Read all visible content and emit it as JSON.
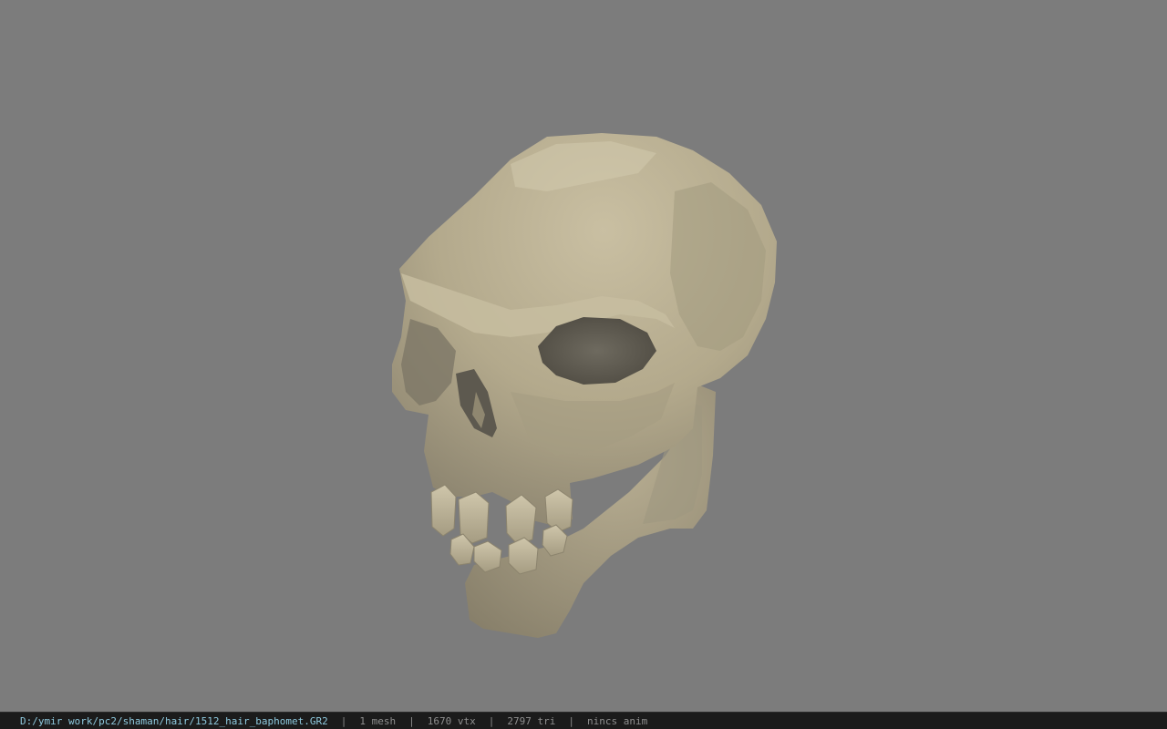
{
  "viewport": {
    "background": "#7c7c7c",
    "model": "skull-mesh"
  },
  "statusbar": {
    "file_path": "D:/ymir work/pc2/shaman/hair/1512_hair_baphomet.GR2",
    "mesh_count": "1 mesh",
    "vertex_count": "1670 vtx",
    "triangle_count": "2797 tri",
    "anim_status": "nincs anim",
    "separator": "|",
    "path_color": "#8ec9de",
    "text_color": "#8f8f8f"
  }
}
